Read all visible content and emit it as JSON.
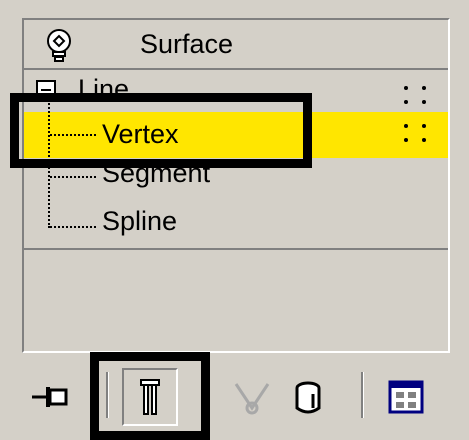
{
  "tree": {
    "root_label": "Surface",
    "root_icon": "lightbulb-icon",
    "items": [
      {
        "label": "Line",
        "icon": "collapse-minus-icon"
      },
      {
        "label": "Vertex",
        "selected": true
      },
      {
        "label": "Segment"
      },
      {
        "label": "Spline"
      }
    ]
  },
  "colors": {
    "selection": "#ffe600",
    "panel_bg": "#d4d0c8",
    "callout_border": "#000000"
  },
  "toolbar": {
    "icons": [
      "pin-stack-icon",
      "show-end-result-icon",
      "make-unique-icon",
      "remove-modifier-icon",
      "configure-modifier-sets-icon"
    ],
    "pressed": "show-end-result-icon"
  }
}
